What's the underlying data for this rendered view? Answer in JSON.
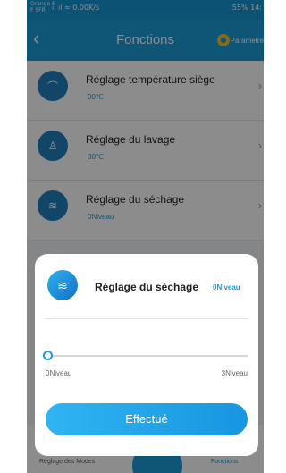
{
  "status_bar": {
    "carrier": "Orange F\nF SFR",
    "left": "ıl ıl ≈ 0.00K/s",
    "right": "55% 14:"
  },
  "header": {
    "back_icon": "chevron-left-icon",
    "title": "Fonctions",
    "params_label": "Paramètre"
  },
  "list": [
    {
      "title": "Réglage température siège",
      "subtitle": "00℃",
      "icon": "thermometer-icon"
    },
    {
      "title": "Réglage du lavage",
      "subtitle": "00℃",
      "icon": "person-icon"
    },
    {
      "title": "Réglage du séchage",
      "subtitle": "0Niveau",
      "icon": "dryer-icon"
    }
  ],
  "tabbar": {
    "left_label": "Réglage des Modes",
    "right_label": "Fonctions"
  },
  "modal": {
    "title": "Réglage du séchage",
    "value": "0Niveau",
    "slider": {
      "min_label": "0Niveau",
      "max_label": "3Niveau",
      "min": 0,
      "max": 3,
      "value": 0
    },
    "button_label": "Effectué"
  },
  "colors": {
    "accent": "#1a9bd8",
    "overlay": "#000000"
  }
}
